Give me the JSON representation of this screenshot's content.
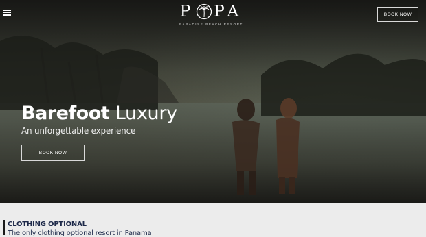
{
  "header": {
    "menu_icon": "hamburger-menu-icon",
    "logo_text": "POPA",
    "logo_tagline": "PARADISE BEACH RESORT",
    "book_now_label": "BOOK NOW"
  },
  "hero": {
    "headline_bold": "Barefoot",
    "headline_light": "Luxury",
    "subline": "An unforgettable experience",
    "book_now_label": "BOOK NOW"
  },
  "section": {
    "heading": "CLOTHING OPTIONAL",
    "subheading": "The only clothing optional resort in Panama"
  },
  "colors": {
    "accent_text": "#1e2a4a",
    "button_border": "#d9d9d9"
  }
}
